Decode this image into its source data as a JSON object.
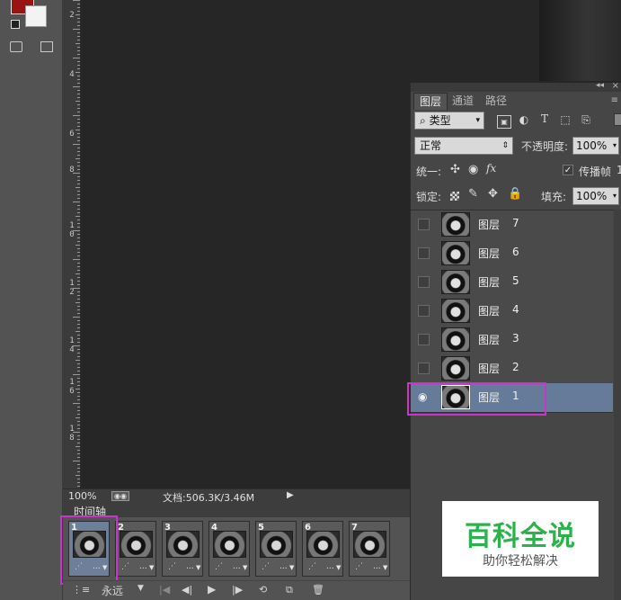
{
  "ruler": {
    "labels": [
      {
        "text": "2",
        "digits": [
          "2"
        ]
      },
      {
        "text": "4",
        "digits": [
          "4"
        ]
      },
      {
        "text": "6",
        "digits": [
          "6"
        ]
      },
      {
        "text": "8",
        "digits": [
          "8"
        ]
      },
      {
        "text": "10",
        "digits": [
          "1",
          "0"
        ]
      },
      {
        "text": "12",
        "digits": [
          "1",
          "2"
        ]
      },
      {
        "text": "14",
        "digits": [
          "1",
          "4"
        ]
      },
      {
        "text": "16",
        "digits": [
          "1",
          "6"
        ]
      },
      {
        "text": "18",
        "digits": [
          "1",
          "8"
        ]
      }
    ]
  },
  "status": {
    "zoom": "100%",
    "doc": "文档:506.3K/3.46M"
  },
  "layers_panel": {
    "tabs": [
      "图层",
      "通道",
      "路径"
    ],
    "filter_label": "类型",
    "blend_mode": "正常",
    "opacity_label": "不透明度:",
    "opacity_value": "100%",
    "unify_label": "统一:",
    "propagate_label": "传播帧",
    "propagate_suffix": "1",
    "lock_label": "锁定:",
    "fill_label": "填充:",
    "fill_value": "100%",
    "layers": [
      {
        "name": "图层",
        "num": "7",
        "visible": false,
        "selected": false
      },
      {
        "name": "图层",
        "num": "6",
        "visible": false,
        "selected": false
      },
      {
        "name": "图层",
        "num": "5",
        "visible": false,
        "selected": false
      },
      {
        "name": "图层",
        "num": "4",
        "visible": false,
        "selected": false
      },
      {
        "name": "图层",
        "num": "3",
        "visible": false,
        "selected": false
      },
      {
        "name": "图层",
        "num": "2",
        "visible": false,
        "selected": false
      },
      {
        "name": "图层",
        "num": "1",
        "visible": true,
        "selected": true
      }
    ]
  },
  "timeline": {
    "title": "时间轴",
    "frames": [
      {
        "num": "1",
        "delay": "...",
        "selected": true
      },
      {
        "num": "2",
        "delay": "...",
        "selected": false
      },
      {
        "num": "3",
        "delay": "...",
        "selected": false
      },
      {
        "num": "4",
        "delay": "...",
        "selected": false
      },
      {
        "num": "5",
        "delay": "...",
        "selected": false
      },
      {
        "num": "6",
        "delay": "...",
        "selected": false
      },
      {
        "num": "7",
        "delay": "...",
        "selected": false
      }
    ],
    "loop": "永远"
  },
  "watermark": {
    "title": "百科全说",
    "subtitle": "助你轻松解决"
  },
  "colors": {
    "foreground": "#9b1414",
    "background": "#f3f3f3",
    "highlight": "#cc33cc",
    "watermark_green": "#2bb24c"
  }
}
